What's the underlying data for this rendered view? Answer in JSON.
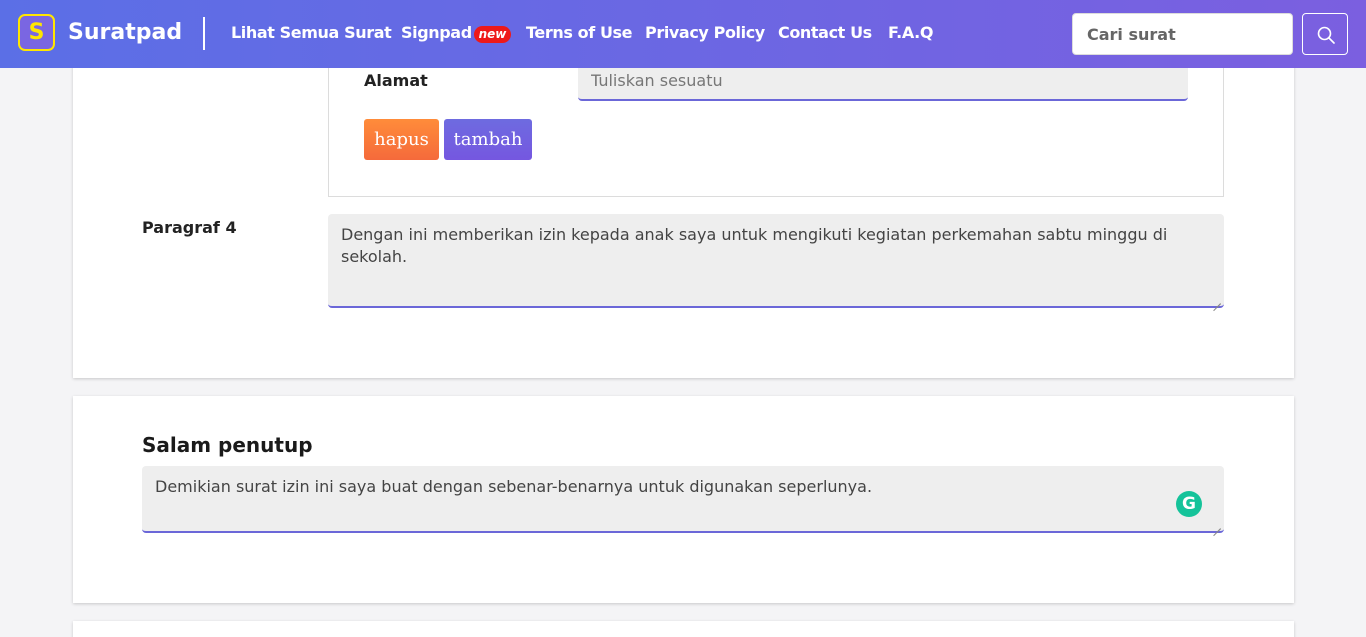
{
  "header": {
    "logo_letter": "S",
    "brand": "Suratpad",
    "nav": [
      {
        "label": "Lihat Semua Surat"
      },
      {
        "label": "Signpad"
      },
      {
        "label": "Terns of Use"
      },
      {
        "label": "Privacy Policy"
      },
      {
        "label": "Contact Us"
      },
      {
        "label": "F.A.Q"
      }
    ],
    "new_badge": "new",
    "search_placeholder": "Cari surat"
  },
  "form": {
    "alamat_label": "Alamat",
    "alamat_placeholder": "Tuliskan sesuatu",
    "hapus_label": "hapus",
    "tambah_label": "tambah",
    "paragraf4_label": "Paragraf 4",
    "paragraf4_value": "Dengan ini memberikan izin kepada anak saya untuk mengikuti kegiatan perkemahan sabtu minggu di sekolah.",
    "salam_title": "Salam penutup",
    "salam_value": "Demikian surat izin ini saya buat dengan sebenar-benarnya untuk digunakan seperlunya."
  },
  "grammarly_letter": "G",
  "colors": {
    "nav_gradient_start": "#5b6fe6",
    "nav_gradient_end": "#7b5fe0",
    "logo_accent": "#ffe600",
    "badge_red": "#ee1919",
    "hapus_orange": "#f57a3a",
    "tambah_purple": "#7060e0",
    "input_underline": "#6b67d8",
    "grammarly_green": "#15c39a"
  },
  "icons": {
    "search": "search-icon",
    "grammarly": "grammarly-icon"
  }
}
